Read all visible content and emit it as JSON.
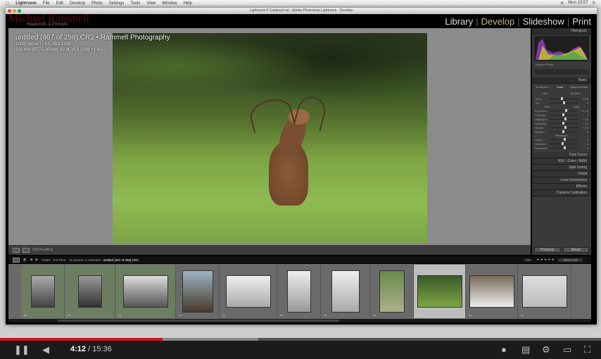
{
  "menubar": {
    "items": [
      "Lightroom",
      "File",
      "Edit",
      "Develop",
      "Photo",
      "Settings",
      "Tools",
      "View",
      "Window",
      "Help"
    ],
    "clock": "Mon 23:57"
  },
  "window": {
    "title": "Lightroom 5 Catalog.lrcat - Adobe Photoshop Lightroom - Develop"
  },
  "identity_plate": {
    "name": "Michael Rammell",
    "tagline": "Headshots & Portraits"
  },
  "modules": [
    {
      "label": "Library"
    },
    {
      "label": "Develop",
      "active": true
    },
    {
      "label": "Slideshow"
    },
    {
      "label": "Print"
    }
  ],
  "photo_info": {
    "title": "untitled (467 of 258).CR2 • Rammell Photography",
    "exposure": "1/320 sec at f / 4.0, ISO 1250",
    "lens": "210 mm (EF70-200mm f/2.8L IS II USM +1.4x)"
  },
  "toolbar": {
    "soft_proofing": "Soft Proofing"
  },
  "right_panel": {
    "histogram": "Histogram",
    "original_photo": "Original Photo",
    "basic": "Basic",
    "treatment": [
      "Treatment :",
      "Color",
      "Black & White"
    ],
    "wb": {
      "label": "WB :",
      "value": "As Shot"
    },
    "sliders": [
      {
        "label": "Temp",
        "value": "0.00"
      },
      {
        "label": "Tint",
        "value": "0"
      },
      {
        "label": "Exposure",
        "value": "+ 0.18"
      },
      {
        "label": "Contrast",
        "value": "0"
      },
      {
        "label": "Highlights",
        "value": "+ 33"
      },
      {
        "label": "Shadows",
        "value": "+ 33"
      },
      {
        "label": "Whites",
        "value": "+ 25"
      },
      {
        "label": "Blacks",
        "value": "0"
      },
      {
        "label": "Clarity",
        "value": "0"
      },
      {
        "label": "Vibrance",
        "value": "0"
      },
      {
        "label": "Saturation",
        "value": "0"
      }
    ],
    "tone_label": "Tone",
    "auto": "Auto",
    "presence": "Presence",
    "sections": [
      "Tone Curve",
      "HSL / Color / B&W",
      "Split Toning",
      "Detail",
      "Lens Corrections",
      "Effects",
      "Camera Calibration"
    ],
    "previous": "Previous",
    "reset": "Reset"
  },
  "filmstrip": {
    "folder": "Folder : For Print",
    "count": "12 photos / 1 selected /",
    "selected": "untitled (467 of 258).CR2",
    "filter_label": "Filter :",
    "filter_value": "Filters Off"
  },
  "video": {
    "current": "4:12",
    "duration": "15:36",
    "played_fraction": 0.27,
    "buffered_fraction": 0.43
  }
}
